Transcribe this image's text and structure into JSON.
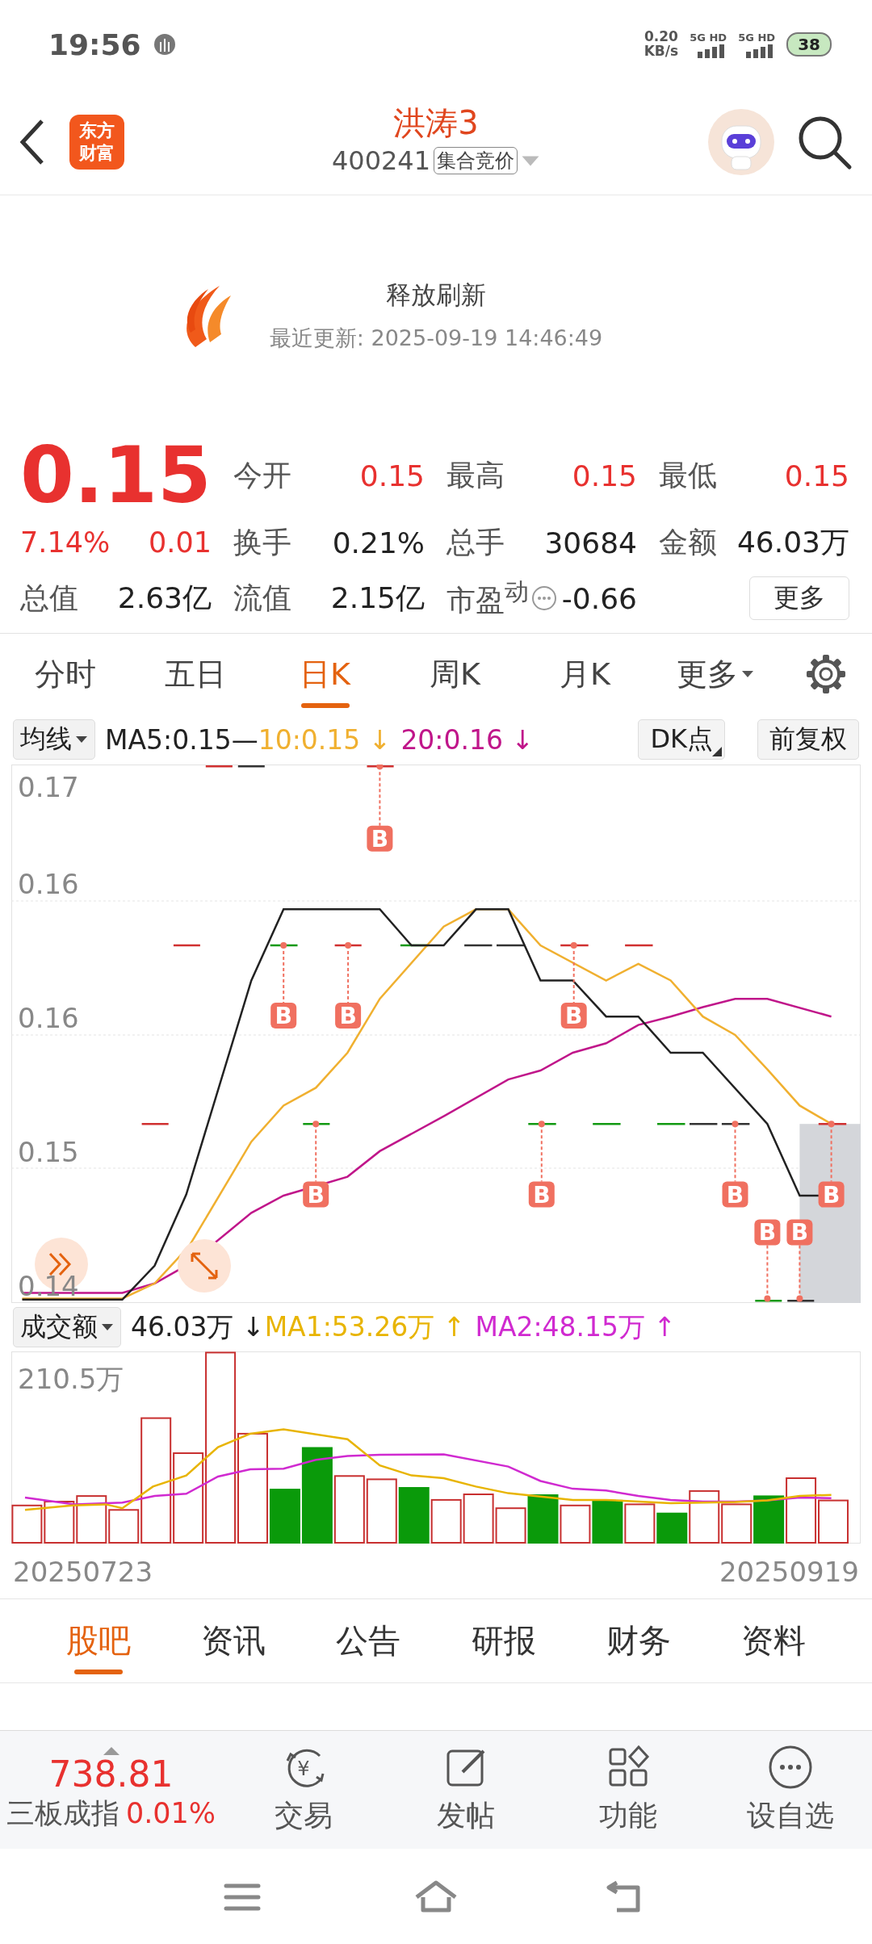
{
  "status_bar": {
    "time": "19:56",
    "net_speed": "0.20",
    "net_unit": "KB/s",
    "networks": [
      "5G HD",
      "5G HD"
    ],
    "battery": "38"
  },
  "header": {
    "logo": [
      "东方",
      "财富"
    ],
    "title": "洪涛3",
    "code": "400241",
    "tag": "集合竞价"
  },
  "refresh": {
    "label": "释放刷新",
    "updated": "最近更新: 2025-09-19 14:46:49"
  },
  "quote": {
    "price": "0.15",
    "change_pct": "7.14%",
    "change": "0.01",
    "stats": [
      {
        "label": "今开",
        "value": "0.15",
        "kind": "up",
        "has_icon": false
      },
      {
        "label": "最高",
        "value": "0.15",
        "kind": "up",
        "has_icon": false
      },
      {
        "label": "最低",
        "value": "0.15",
        "kind": "up",
        "has_icon": false
      },
      {
        "label": "换手",
        "value": "0.21%",
        "kind": "plain",
        "has_icon": false
      },
      {
        "label": "总手",
        "value": "30684",
        "kind": "plain",
        "has_icon": false
      },
      {
        "label": "金额",
        "value": "46.03万",
        "kind": "plain",
        "has_icon": false
      },
      {
        "label": "总值",
        "value": "2.63亿",
        "kind": "plain",
        "has_icon": false
      },
      {
        "label": "流值",
        "value": "2.15亿",
        "kind": "plain",
        "has_icon": false
      },
      {
        "label": "市盈$^{动}$",
        "value": "-0.66",
        "kind": "plain",
        "has_icon": true
      }
    ],
    "more_button": "更多"
  },
  "period_tabs": [
    {
      "label": "分时",
      "selected": false,
      "kind": "tab"
    },
    {
      "label": "五日",
      "selected": false,
      "kind": "tab"
    },
    {
      "label": "日K",
      "selected": true,
      "kind": "tab"
    },
    {
      "label": "周K",
      "selected": false,
      "kind": "tab"
    },
    {
      "label": "月K",
      "selected": false,
      "kind": "tab"
    },
    {
      "label": "更多",
      "selected": false,
      "kind": "dropdown"
    }
  ],
  "ma_legend": {
    "selector": "均线",
    "lines": [
      {
        "text": "MA5:0.15—",
        "color": "#222222"
      },
      {
        "text": "10:0.15 ↓",
        "color": "#f0b030"
      },
      {
        "text": "20:0.16 ↓",
        "color": "#c0168a"
      }
    ],
    "dk_button": "DK点",
    "adjust_button": "前复权"
  },
  "price_chart": {
    "y_labels": [
      "0.17",
      "0.16",
      "0.16",
      "0.15",
      "0.14"
    ],
    "markers": [
      "B",
      "B",
      "B",
      "B",
      "B",
      "B",
      "B",
      "B",
      "B",
      "B"
    ]
  },
  "volume": {
    "selector": "成交额",
    "lines": [
      {
        "text": "46.03万 ↓",
        "color": "#222222"
      },
      {
        "text": "MA1:53.26万 ↑",
        "color": "#e8b400"
      },
      {
        "text": "MA2:48.15万 ↑",
        "color": "#d02ad0"
      }
    ],
    "max_label": "210.5万",
    "start_date": "20250723",
    "end_date": "20250919"
  },
  "content_tabs": [
    {
      "label": "股吧",
      "selected": true
    },
    {
      "label": "资讯",
      "selected": false
    },
    {
      "label": "公告",
      "selected": false
    },
    {
      "label": "研报",
      "selected": false
    },
    {
      "label": "财务",
      "selected": false
    },
    {
      "label": "资料",
      "selected": false
    }
  ],
  "bottom_bar": {
    "index_value": "738.81",
    "index_name": "三板成指",
    "index_change": "0.01%",
    "actions": [
      {
        "label": "交易",
        "kind": "trade",
        "glyph": "¥"
      },
      {
        "label": "发帖",
        "kind": "post"
      },
      {
        "label": "功能",
        "kind": "features"
      },
      {
        "label": "设自选",
        "kind": "watch"
      }
    ]
  }
}
